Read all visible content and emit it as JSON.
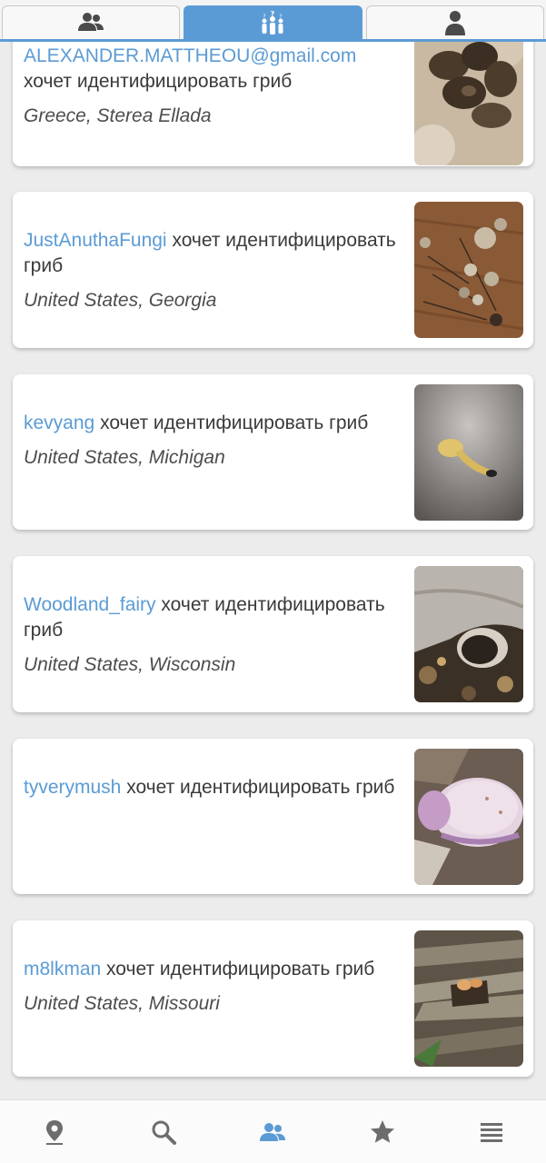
{
  "top_tabs": [
    {
      "icon": "users-icon",
      "active": false
    },
    {
      "icon": "community-question-icon",
      "active": true
    },
    {
      "icon": "user-icon",
      "active": false
    }
  ],
  "feed": {
    "action_text": "хочет идентифицировать гриб",
    "items": [
      {
        "user": "ALEXANDER.MATTHEOU@gmail.com",
        "action": "хочет идентифицировать гриб",
        "location": "Greece, Sterea Ellada"
      },
      {
        "user": "JustAnuthaFungi",
        "action": "хочет идентифицировать гриб",
        "location": "United States, Georgia"
      },
      {
        "user": "kevyang",
        "action": "хочет идентифицировать гриб",
        "location": "United States, Michigan"
      },
      {
        "user": "Woodland_fairy",
        "action": "хочет идентифицировать гриб",
        "location": "United States, Wisconsin"
      },
      {
        "user": "tyverymush",
        "action": "хочет идентифицировать гриб",
        "location": ""
      },
      {
        "user": "m8lkman",
        "action": "хочет идентифицировать гриб",
        "location": "United States, Missouri"
      }
    ]
  },
  "bottom_nav": [
    {
      "icon": "map-pin-icon",
      "active": false
    },
    {
      "icon": "search-icon",
      "active": false
    },
    {
      "icon": "community-icon",
      "active": true
    },
    {
      "icon": "star-icon",
      "active": false
    },
    {
      "icon": "menu-icon",
      "active": false
    }
  ],
  "colors": {
    "accent": "#5b9bd5",
    "inactive_icon": "#6d6d6d",
    "background": "#ececec"
  }
}
